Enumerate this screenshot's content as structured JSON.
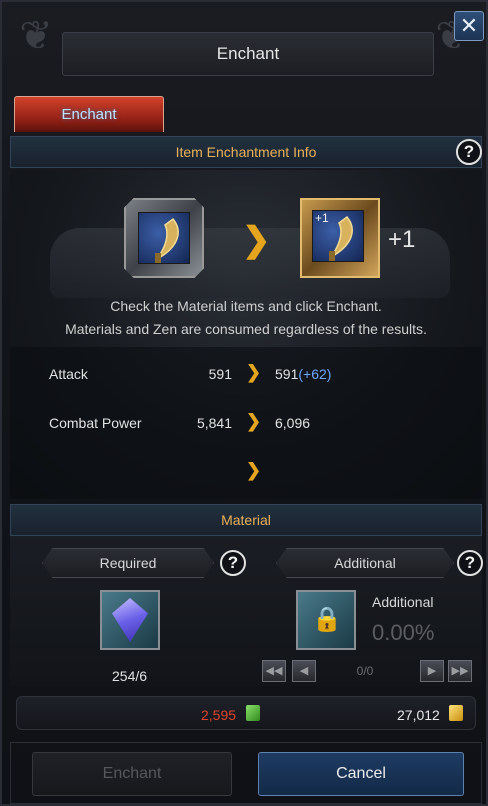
{
  "window": {
    "title": "Enchant",
    "close_icon": "close-icon"
  },
  "tabs": [
    {
      "label": "Enchant",
      "active": true
    }
  ],
  "enchant_info": {
    "header": "Item Enchantment Info",
    "source_item": {
      "icon": "blade-icon"
    },
    "result_item": {
      "icon": "blade-icon",
      "badge": "+1"
    },
    "result_level": "+1",
    "message_line1": "Check the Material items and click Enchant.",
    "message_line2": "Materials and Zen are consumed regardless of the results."
  },
  "stats": [
    {
      "label": "Attack",
      "current": "591",
      "next": "591",
      "bonus": "(+62)"
    },
    {
      "label": "Combat Power",
      "current": "5,841",
      "next": "6,096",
      "bonus": ""
    }
  ],
  "material": {
    "header": "Material",
    "required_label": "Required",
    "required_count": "254/6",
    "required_icon": "gem-icon",
    "additional_label": "Additional",
    "additional_slot_label": "Additional",
    "additional_rate": "0.00%",
    "additional_icon": "lock-icon",
    "page": "0/0"
  },
  "currency": {
    "gems": "2,595",
    "gems_color": "#e0442c",
    "gems_icon": "green-gem-icon",
    "zen": "27,012",
    "zen_color": "#e8e8e8",
    "zen_icon": "gold-coin-icon"
  },
  "buttons": {
    "enchant": "Enchant",
    "cancel": "Cancel"
  },
  "colors": {
    "accent_gold": "#e8b15a",
    "cancel_blue": "#1e3b63",
    "tab_red": "#c0392b"
  }
}
